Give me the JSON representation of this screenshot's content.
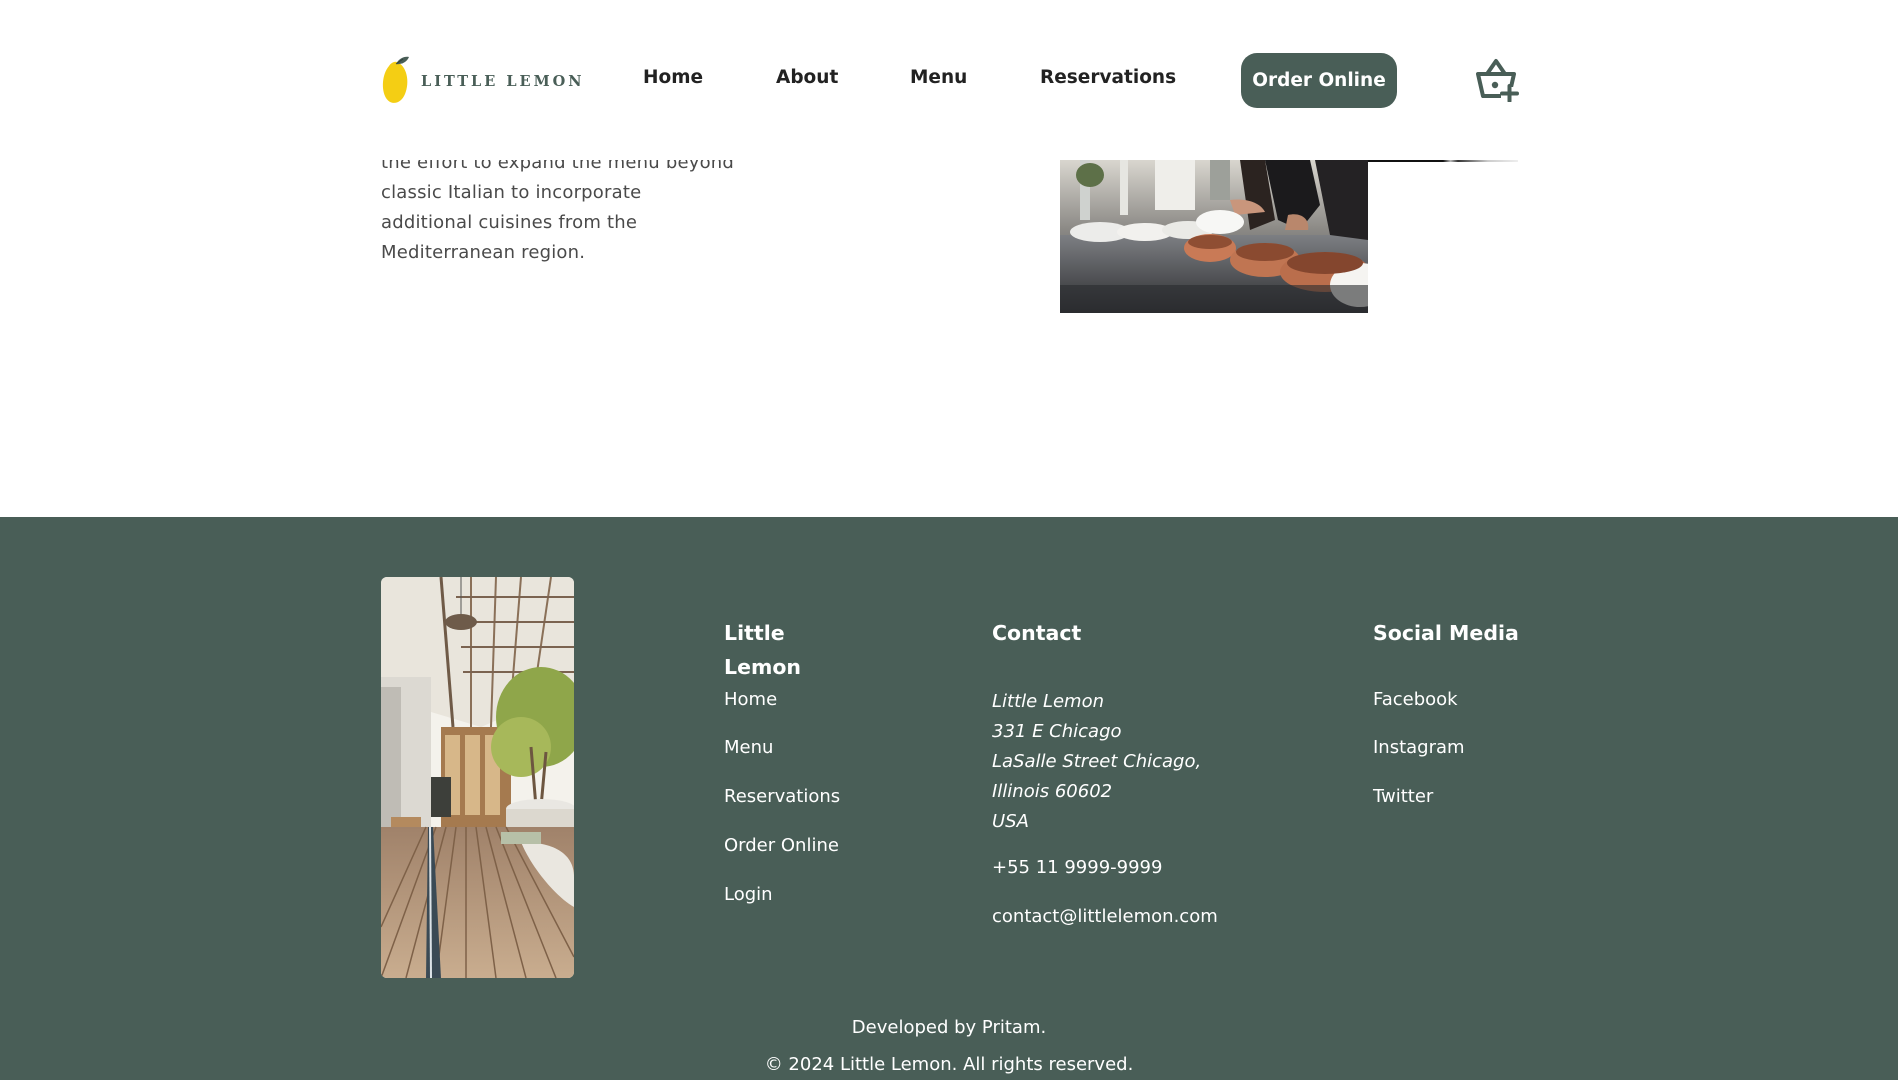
{
  "header": {
    "logo_text": "LITTLE LEMON",
    "nav": [
      {
        "label": "Home"
      },
      {
        "label": "About"
      },
      {
        "label": "Menu"
      },
      {
        "label": "Reservations"
      }
    ],
    "order_button": "Order Online",
    "cart_icon": "basket-plus-icon"
  },
  "about": {
    "paragraph_lines": [
      "the effort to expand the menu beyond",
      "classic Italian to incorporate",
      "additional cuisines from the",
      "Mediterranean region."
    ]
  },
  "footer": {
    "col1": {
      "title_line1": "Little",
      "title_line2": "Lemon",
      "links": [
        "Home",
        "Menu",
        "Reservations",
        "Order Online",
        "Login"
      ]
    },
    "contact": {
      "title": "Contact",
      "address": [
        "Little Lemon",
        "331 E Chicago",
        "LaSalle Street Chicago,",
        "Illinois 60602",
        "USA"
      ],
      "phone": "+55 11 9999-9999",
      "email": "contact@littlelemon.com"
    },
    "social": {
      "title": "Social Media",
      "links": [
        "Facebook",
        "Instagram",
        "Twitter"
      ]
    },
    "developed_by": "Developed by Pritam.",
    "copyright": "© 2024 Little Lemon. All rights reserved."
  },
  "colors": {
    "primary_green": "#495e57",
    "lemon_yellow": "#f4ce14",
    "white": "#ffffff"
  }
}
